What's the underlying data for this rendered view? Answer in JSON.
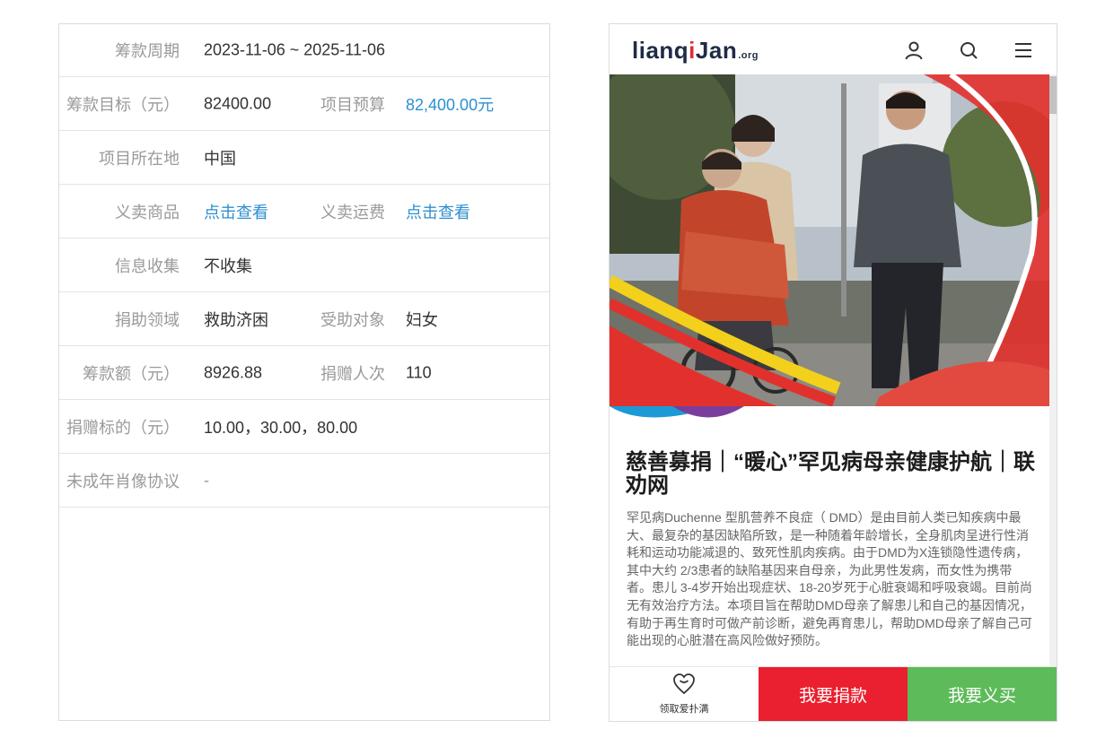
{
  "info_table": {
    "rows": [
      {
        "label": "筹款周期",
        "value": "2023-11-06 ~ 2025-11-06"
      },
      {
        "label": "筹款目标（元）",
        "value": "82400.00",
        "label2": "项目预算",
        "value2": "82,400.00元"
      },
      {
        "label": "项目所在地",
        "value": "中国"
      },
      {
        "label": "义卖商品",
        "value": "点击查看",
        "label2": "义卖运费",
        "value2": "点击查看"
      },
      {
        "label": "信息收集",
        "value": "不收集"
      },
      {
        "label": "捐助领域",
        "value": "救助济困",
        "label2": "受助对象",
        "value2": "妇女"
      },
      {
        "label": "筹款额（元）",
        "value": "8926.88",
        "label2": "捐赠人次",
        "value2": "110"
      },
      {
        "label": "捐赠标的（元）",
        "value": "10.00，30.00，80.00"
      },
      {
        "label": "未成年肖像协议",
        "value": "-"
      }
    ]
  },
  "mobile": {
    "logo": {
      "part1": "lianq",
      "mark": "i",
      "part2": "Jan",
      "suffix": ".org"
    },
    "header_icons": [
      "user-icon",
      "search-icon",
      "menu-icon"
    ],
    "title": "慈善募捐｜“暖心”罕见病母亲健康护航｜联劝网",
    "description": "罕见病Duchenne 型肌营养不良症（ DMD）是由目前人类已知疾病中最大、最复杂的基因缺陷所致，是一种随着年龄增长，全身肌肉呈进行性消耗和运动功能减退的、致死性肌肉疾病。由于DMD为X连锁隐性遗传病，其中大约 2/3患者的缺陷基因来自母亲，为此男性发病，而女性为携带者。患儿 3-4岁开始出现症状、18-20岁死于心脏衰竭和呼吸衰竭。目前尚无有效治疗方法。本项目旨在帮助DMD母亲了解患儿和自己的基因情况，有助于再生育时可做产前诊断，避免再育患儿，帮助DMD母亲了解自己可能出现的心脏潜在高风险做好预防。",
    "bottom_bar": {
      "heart_caption": "领取爱扑满",
      "donate_label": "我要捐款",
      "buy_label": "我要义买"
    }
  },
  "colors": {
    "link": "#2d8fd1",
    "donate": "#ea1f2f",
    "buy": "#5dbb5a",
    "label_gray": "#9a9a9a"
  }
}
